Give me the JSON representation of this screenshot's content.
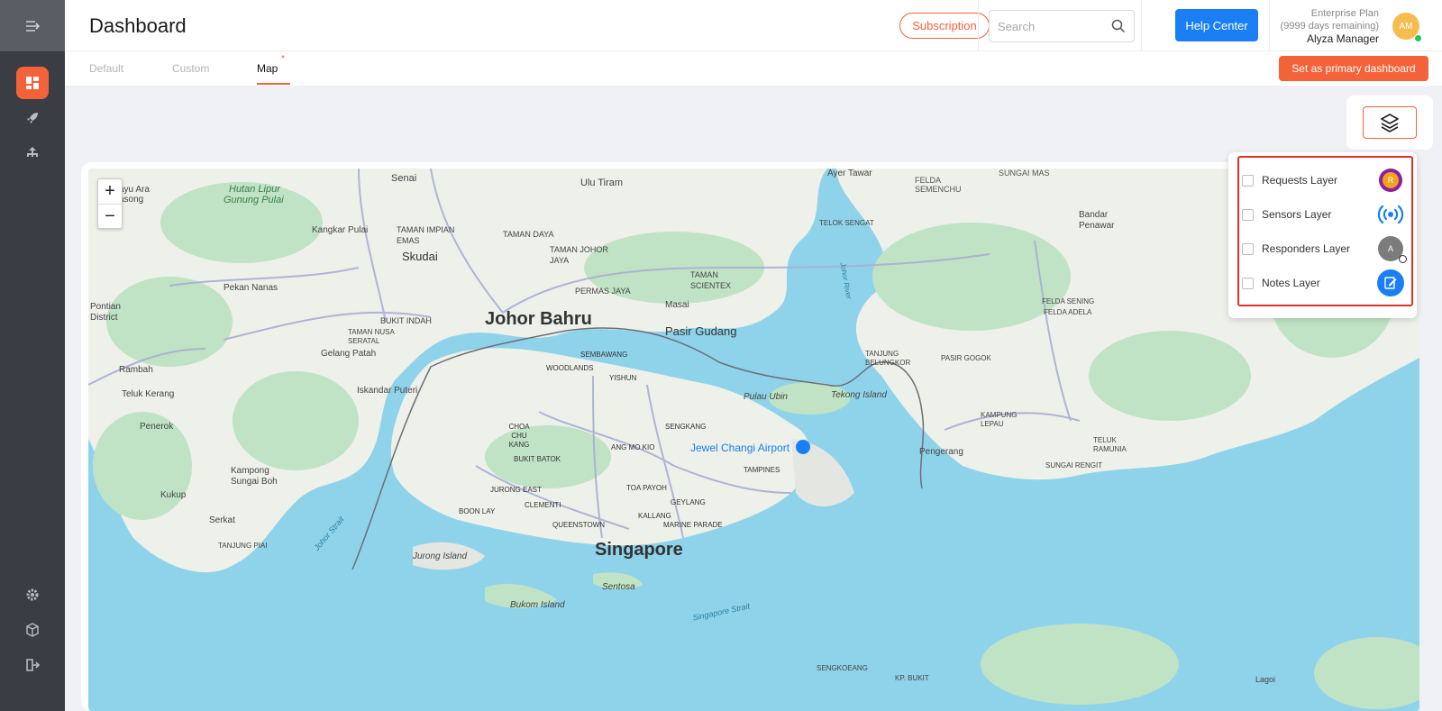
{
  "header": {
    "title": "Dashboard",
    "subscription_label": "Subscription",
    "search_placeholder": "Search",
    "help_label": "Help Center",
    "plan": "Enterprise Plan",
    "days_remaining": "(9999 days remaining)",
    "user_name": "Alyza Manager",
    "avatar_initials": "AM"
  },
  "tabs": [
    {
      "label": "Default"
    },
    {
      "label": "Custom"
    },
    {
      "label": "Map",
      "active": true,
      "marker": "*"
    }
  ],
  "primary_dashboard_label": "Set as primary dashboard",
  "sidebar": {
    "items": [
      {
        "icon": "menu-collapse-icon"
      },
      {
        "icon": "dashboard-icon",
        "active": true
      },
      {
        "icon": "rocket-icon"
      },
      {
        "icon": "sitemap-icon"
      },
      {
        "icon": "gear-icon"
      },
      {
        "icon": "cube-icon"
      },
      {
        "icon": "logout-icon"
      }
    ]
  },
  "map": {
    "zoom_in": "+",
    "zoom_out": "−",
    "labels": {
      "johor_bahru": "Johor Bahru",
      "singapore": "Singapore",
      "pasir_gudang": "Pasir Gudang",
      "skudai": "Skudai",
      "jewel": "Jewel Changi Airport",
      "ulu_tiram": "Ulu Tiram",
      "senai": "Senai",
      "ayer_tawar": "Ayer Tawar",
      "sungai_mas": "SUNGAI MAS",
      "felda_semenchu": "FELDA SEMENCHU",
      "hutan_lipur": "Hutan Lipur",
      "gunung_pulai": "Gunung Pulai",
      "ayu_ara": "ayu Ara",
      "asong": "asong",
      "kangkar_pulai": "Kangkar Pulai",
      "taman_impian": "TAMAN IMPIAN EMAS",
      "taman_daya": "TAMAN DAYA",
      "taman_johor_jaya": "TAMAN JOHOR JAYA",
      "taman_scientex": "TAMAN SCIENTEX",
      "permas_jaya": "PERMAS JAYA",
      "masai": "Masai",
      "pekan_nanas": "Pekan Nanas",
      "pontian_district": "Pontian District",
      "bukit_indah": "BUKIT INDAH",
      "taman_nusa": "TAMAN NUSA SERATAL",
      "gelang_patah": "Gelang Patah",
      "rambah": "Rambah",
      "teluk_kerang": "Teluk Kerang",
      "iskandar_puteri": "Iskandar Puteri",
      "penerok": "Penerok",
      "kampong_sungai_boh": "Kampong Sungai Boh",
      "kukup": "Kukup",
      "serkat": "Serkat",
      "tanjung_piai": "TANJUNG PIAI",
      "johor_strait": "Johor Strait",
      "jurong_island": "Jurong Island",
      "bukom_island": "Bukom Island",
      "sentosa": "Sentosa",
      "singapore_strait": "Singapore Strait",
      "sembawang": "SEMBAWANG",
      "woodlands": "WOODLANDS",
      "yishun": "YISHUN",
      "sengkang": "SENGKANG",
      "choa_chu_kang": "CHOA CHU KANG",
      "ang_mo_kio": "ANG MO KIO",
      "bukit_batok": "BUKIT BATOK",
      "jurong_east": "JURONG EAST",
      "clementi": "CLEMENTI",
      "boon_lay": "BOON LAY",
      "toa_payoh": "TOA PAYOH",
      "tampines": "TAMPINES",
      "geylang": "GEYLANG",
      "kallang": "KALLANG",
      "marine_parade": "MARINE PARADE",
      "queenstown": "QUEENSTOWN",
      "pulau_ubin": "Pulau Ubin",
      "tekong": "Tekong Island",
      "tanjung_belungkor": "TANJUNG BELUNGKOR",
      "pasir_gogok": "PASIR GOGOK",
      "pengerang": "Pengerang",
      "kampung_lepau": "KAMPUNG LEPAU",
      "felda_sening": "FELDA SENING",
      "felda_adela": "FELDA ADELA",
      "bandar_penawar": "Bandar Penawar",
      "telok_sengat": "TELOK SENGAT",
      "sungai_rengit": "SUNGAI RENGIT",
      "teluk_ramunia": "TELUK RAMUNIA",
      "sengkoeang": "SENGKOEANG",
      "kp_bukit": "KP. BUKIT",
      "lagoi": "Lagoi",
      "johor_river": "Johor River"
    }
  },
  "layers": [
    {
      "label": "Requests Layer",
      "icon": "request-icon",
      "badge": "R",
      "checked": false
    },
    {
      "label": "Sensors Layer",
      "icon": "sensor-broadcast-icon",
      "checked": false
    },
    {
      "label": "Responders Layer",
      "icon": "responder-icon",
      "badge": "A",
      "checked": false
    },
    {
      "label": "Notes Layer",
      "icon": "note-icon",
      "checked": false
    }
  ],
  "colors": {
    "accent": "#f4623a",
    "primary_blue": "#1a7ff4",
    "sidebar": "#3a3d44",
    "water": "#8fd3ea",
    "land": "#eef0ea",
    "green": "#bfe3c4"
  }
}
